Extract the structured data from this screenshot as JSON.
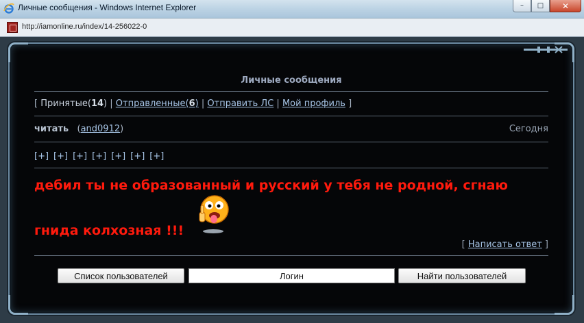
{
  "window": {
    "title": "Личные сообщения - Windows Internet Explorer",
    "controls": {
      "minimize": "–",
      "maximize": "□",
      "close": "✕"
    }
  },
  "address": {
    "url": "http://iamonline.ru/index/14-256022-0"
  },
  "page": {
    "section_title": "Личные сообщения",
    "nav": {
      "open_bracket": "[",
      "inbox_label": "Принятые",
      "inbox_count": "14",
      "sep1": "|",
      "sent_label": "Отправленные",
      "sent_count": "6",
      "sep2": "|",
      "send_label": "Отправить ЛС",
      "sep3": "|",
      "profile_label": "Мой профиль",
      "close_bracket": "]"
    },
    "message": {
      "read_label": "читать",
      "sender": "and0912",
      "date": "Сегодня",
      "plus_buttons": [
        "[+]",
        "[+]",
        "[+]",
        "[+]",
        "[+]",
        "[+]",
        "[+]"
      ],
      "line1": "дебил ты не образованный и русский у тебя не родной, сгнаю",
      "line2": "гнида колхозная !!!",
      "reply_open": "[",
      "reply_label": "Написать ответ",
      "reply_close": "]"
    },
    "bottom": {
      "users_button": "Список пользователей",
      "login_field": "Логин",
      "find_button": "Найти пользователей"
    }
  },
  "colors": {
    "message_text": "#ff1a0d",
    "page_background": "#050608",
    "link": "#a8c6e8"
  },
  "icons": [
    "ie-logo-icon",
    "site-favicon-icon",
    "smiley-tongue-icon"
  ]
}
